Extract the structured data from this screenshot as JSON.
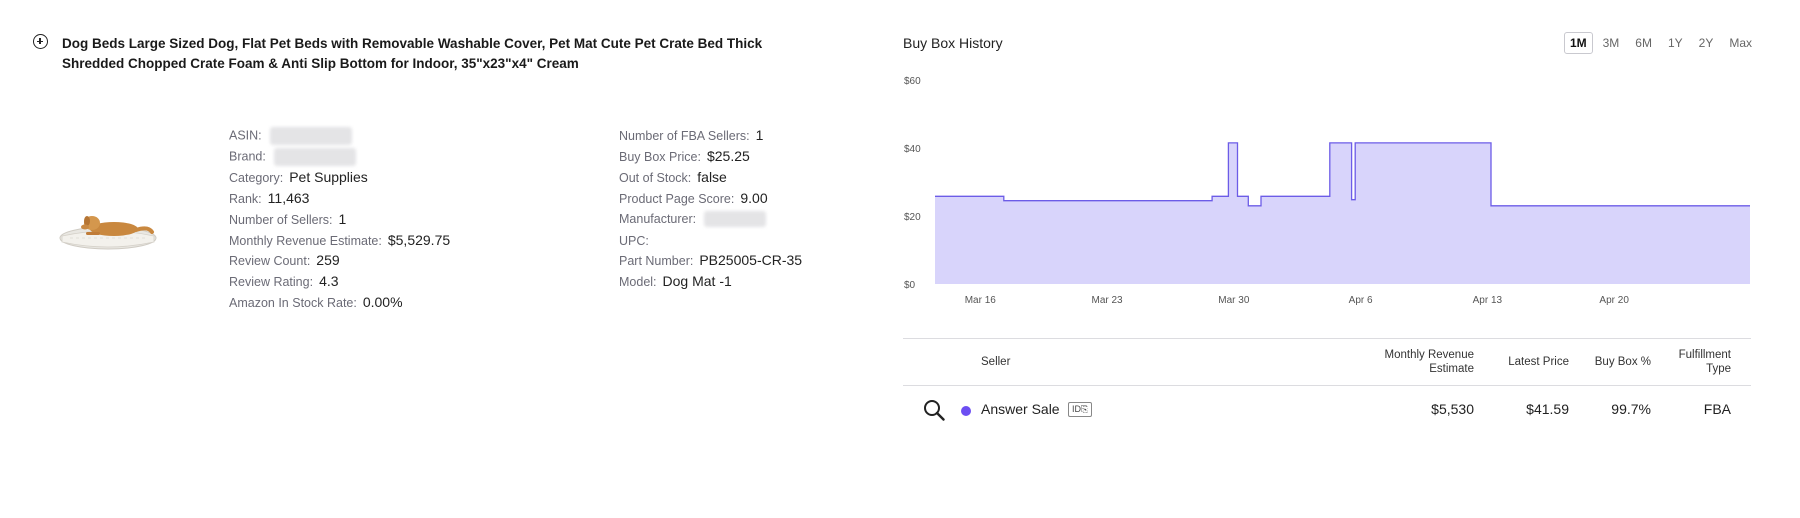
{
  "product": {
    "title": "Dog Beds Large Sized Dog, Flat Pet Beds with Removable Washable Cover, Pet Mat Cute Pet Crate Bed Thick Shredded Chopped Crate Foam & Anti Slip Bottom for Indoor, 35\"x23\"x4\" Cream",
    "image_icon": "dog-bed-image"
  },
  "details_left": [
    {
      "label": "ASIN:",
      "value": "",
      "redacted": true
    },
    {
      "label": "Brand:",
      "value": "",
      "redacted": true
    },
    {
      "label": "Category:",
      "value": "Pet Supplies"
    },
    {
      "label": "Rank:",
      "value": "11,463"
    },
    {
      "label": "Number of Sellers:",
      "value": "1"
    },
    {
      "label": "Monthly Revenue Estimate:",
      "value": "$5,529.75"
    },
    {
      "label": "Review Count:",
      "value": "259"
    },
    {
      "label": "Review Rating:",
      "value": "4.3"
    },
    {
      "label": "Amazon In Stock Rate:",
      "value": "0.00%"
    }
  ],
  "details_right": [
    {
      "label": "Number of FBA Sellers:",
      "value": "1"
    },
    {
      "label": "Buy Box Price:",
      "value": "$25.25"
    },
    {
      "label": "Out of Stock:",
      "value": "false"
    },
    {
      "label": "Product Page Score:",
      "value": "9.00"
    },
    {
      "label": "Manufacturer:",
      "value": "",
      "redacted": true
    },
    {
      "label": "UPC:",
      "value": ""
    },
    {
      "label": "Part Number:",
      "value": "PB25005-CR-35"
    },
    {
      "label": "Model:",
      "value": "Dog Mat -1"
    }
  ],
  "buy_box": {
    "title": "Buy Box History",
    "ranges": [
      "1M",
      "3M",
      "6M",
      "1Y",
      "2Y",
      "Max"
    ],
    "active_range": "1M"
  },
  "chart_data": {
    "type": "area",
    "title": "Buy Box History",
    "xlabel": "",
    "ylabel": "",
    "ylim": [
      0,
      60
    ],
    "y_ticks": [
      "$0",
      "$20",
      "$40",
      "$60"
    ],
    "x_ticks": [
      "Mar 16",
      "Mar 23",
      "Mar 30",
      "Apr 6",
      "Apr 13",
      "Apr 20"
    ],
    "x_tick_days": [
      16,
      23,
      30,
      37,
      44,
      51
    ],
    "xlim_days": [
      13.5,
      58.5
    ],
    "grid": false,
    "fill_color": "#d8d4fb",
    "line_color": "#6c5ce7",
    "series": [
      {
        "x": [
          13.5,
          17.3,
          17.3,
          28.8,
          28.8,
          29.7,
          29.7,
          30.2,
          30.2,
          30.8,
          30.8,
          31.5,
          31.5,
          35.3,
          35.3,
          36.5,
          36.5,
          36.7,
          36.7,
          44.2,
          44.2,
          50.3,
          50.3,
          58.5
        ],
        "y": [
          25.8,
          25.8,
          24.5,
          24.5,
          25.8,
          25.8,
          41.5,
          41.5,
          25.8,
          25.8,
          23.0,
          23.0,
          25.8,
          25.8,
          41.5,
          41.5,
          24.8,
          24.8,
          41.5,
          41.5,
          23.0,
          23.0,
          23.0,
          23.0
        ]
      }
    ]
  },
  "seller_table": {
    "headers": {
      "seller": "Seller",
      "revenue_line1": "Monthly Revenue",
      "revenue_line2": "Estimate",
      "price": "Latest Price",
      "buybox": "Buy Box %",
      "fulfill_line1": "Fulfillment",
      "fulfill_line2": "Type"
    },
    "rows": [
      {
        "seller": "Answer Sale",
        "badge": "ID",
        "dot_color": "#6c4ef2",
        "revenue": "$5,530",
        "price": "$41.59",
        "buybox": "99.7%",
        "fulfillment": "FBA"
      }
    ]
  }
}
